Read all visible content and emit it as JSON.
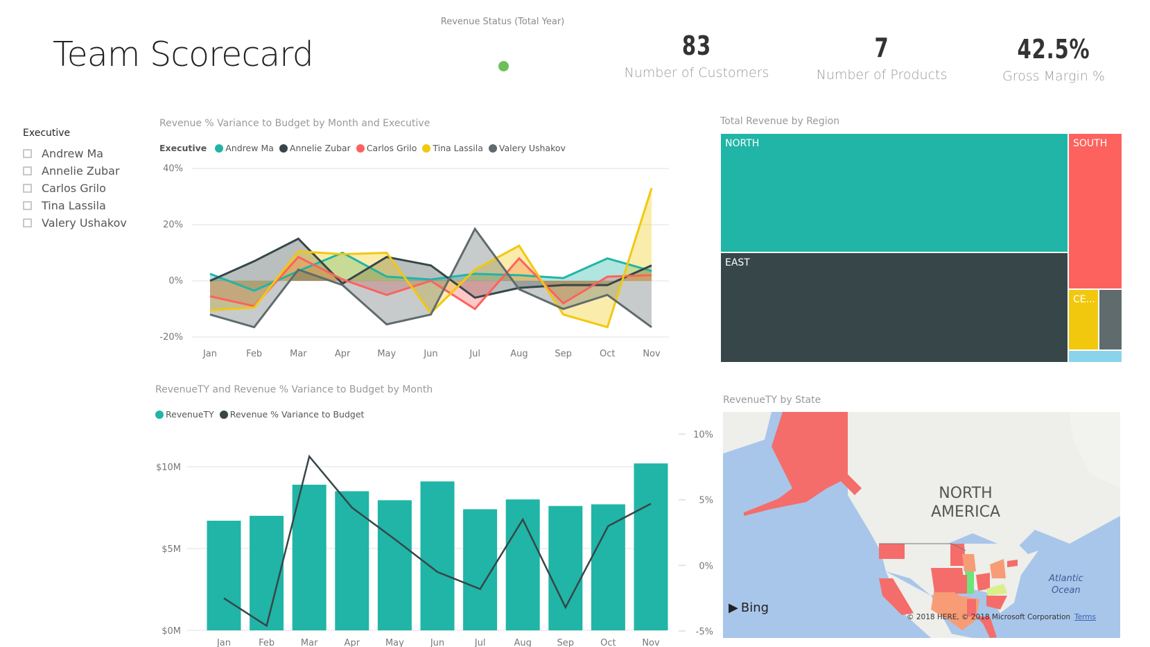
{
  "page": {
    "title": "Team Scorecard"
  },
  "revenue_status": {
    "label": "Revenue Status (Total Year)",
    "status_color": "#6dbf5a"
  },
  "kpis": [
    {
      "value": "83",
      "label": "Number of Customers"
    },
    {
      "value": "7",
      "label": "Number of Products"
    },
    {
      "value": "42.5%",
      "label": "Gross Margin %"
    }
  ],
  "slicer": {
    "header": "Executive",
    "items": [
      {
        "label": "Andrew Ma",
        "checked": false
      },
      {
        "label": "Annelie Zubar",
        "checked": false
      },
      {
        "label": "Carlos Grilo",
        "checked": false
      },
      {
        "label": "Tina Lassila",
        "checked": false
      },
      {
        "label": "Valery Ushakov",
        "checked": false
      }
    ]
  },
  "colors": {
    "teal": "#20b5a6",
    "dark": "#374649",
    "red": "#fd625e",
    "yellow": "#f2c80f",
    "grey": "#5f6b6d",
    "lightblue": "#8ad4eb"
  },
  "chart_data": [
    {
      "type": "area",
      "title": "Revenue % Variance to Budget by Month and Executive",
      "legend_title": "Executive",
      "legend_position": "top-left",
      "categories": [
        "Jan",
        "Feb",
        "Mar",
        "Apr",
        "May",
        "Jun",
        "Jul",
        "Aug",
        "Sep",
        "Oct",
        "Nov"
      ],
      "ylim": [
        -20,
        40
      ],
      "yticks": [
        -20,
        0,
        20,
        40
      ],
      "ytick_labels": [
        "-20%",
        "0%",
        "20%",
        "40%"
      ],
      "grid": true,
      "series": [
        {
          "name": "Andrew Ma",
          "color": "#20b5a6",
          "values": [
            2.5,
            -3.5,
            3.5,
            10,
            1.5,
            0.5,
            2.5,
            2,
            1,
            8,
            3.5
          ]
        },
        {
          "name": "Annelie Zubar",
          "color": "#374649",
          "values": [
            0,
            7,
            15,
            -1,
            8.5,
            5.5,
            -6,
            -2.5,
            -1.5,
            -1.5,
            5.5
          ]
        },
        {
          "name": "Carlos Grilo",
          "color": "#fd625e",
          "values": [
            -5.5,
            -9,
            8.5,
            0.5,
            -5,
            0,
            -10,
            8,
            -8,
            1.5,
            2
          ]
        },
        {
          "name": "Tina Lassila",
          "color": "#f2c80f",
          "values": [
            -10.5,
            -9.5,
            10.5,
            9.5,
            10,
            -11.5,
            4,
            12.5,
            -12,
            -16.5,
            33
          ]
        },
        {
          "name": "Valery Ushakov",
          "color": "#5f6b6d",
          "values": [
            -12,
            -16.5,
            4,
            -1.5,
            -15.5,
            -12,
            18.5,
            -3,
            -10,
            -5,
            -16.5
          ]
        }
      ]
    },
    {
      "type": "bar",
      "title": "RevenueTY and Revenue % Variance to Budget by Month",
      "legend_position": "top-left",
      "categories": [
        "Jan",
        "Feb",
        "Mar",
        "Apr",
        "May",
        "Jun",
        "Jul",
        "Aug",
        "Sep",
        "Oct",
        "Nov"
      ],
      "ylim": [
        0,
        10
      ],
      "yticks": [
        0,
        5,
        10
      ],
      "ytick_labels": [
        "$0M",
        "$5M",
        "$10M"
      ],
      "y2lim": [
        -5,
        10
      ],
      "y2ticks": [
        -5,
        0,
        5,
        10
      ],
      "y2tick_labels": [
        "-5%",
        "0%",
        "5%",
        "10%"
      ],
      "grid": true,
      "series": [
        {
          "name": "RevenueTY",
          "type": "bar",
          "axis": "left",
          "unit": "$M",
          "color": "#20b5a6",
          "values": [
            6.7,
            7.0,
            8.9,
            8.5,
            7.95,
            9.1,
            7.4,
            8.0,
            7.6,
            7.7,
            10.2
          ]
        },
        {
          "name": "Revenue % Variance to Budget",
          "type": "line",
          "axis": "right",
          "unit": "%",
          "color": "#374649",
          "values": [
            -2.5,
            -4.6,
            8.3,
            4.4,
            2.0,
            -0.5,
            -1.8,
            3.5,
            -3.2,
            3.0,
            4.7
          ]
        }
      ]
    }
  ],
  "treemap": {
    "title": "Total Revenue by Region",
    "cells": [
      {
        "label": "NORTH",
        "color": "#20b5a6"
      },
      {
        "label": "EAST",
        "color": "#374649"
      },
      {
        "label": "SOUTH",
        "color": "#fd625e"
      },
      {
        "label": "CE...",
        "color": "#f2c80f"
      },
      {
        "label": "",
        "color": "#5f6b6d"
      },
      {
        "label": "",
        "color": "#8ad4eb"
      }
    ]
  },
  "map": {
    "title": "RevenueTY by State",
    "continent_label_1": "NORTH",
    "continent_label_2": "AMERICA",
    "ocean_label_1": "Atlantic",
    "ocean_label_2": "Ocean",
    "provider": "Bing",
    "copyright": "© 2018 HERE, © 2018 Microsoft Corporation",
    "terms": "Terms"
  }
}
